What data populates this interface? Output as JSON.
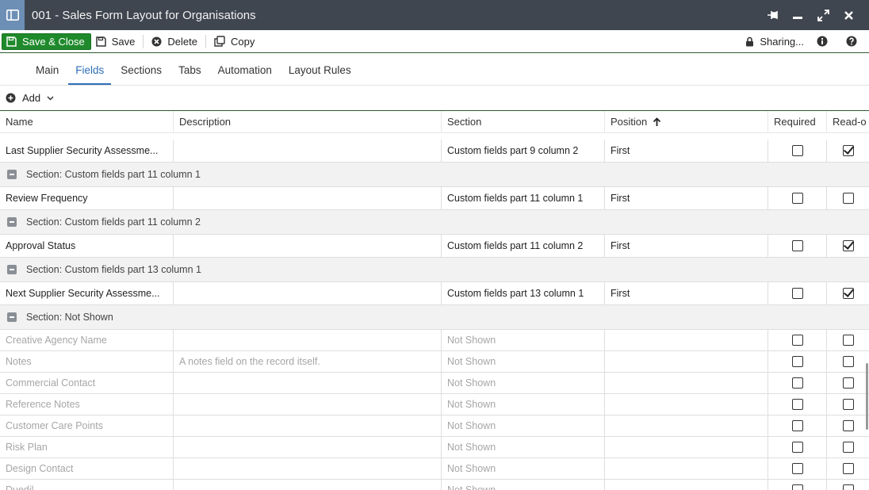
{
  "window": {
    "title": "001 - Sales Form Layout for Organisations"
  },
  "toolbar": {
    "save_close_label": "Save & Close",
    "save_label": "Save",
    "delete_label": "Delete",
    "copy_label": "Copy",
    "sharing_label": "Sharing..."
  },
  "tabs": [
    {
      "label": "Main",
      "active": false
    },
    {
      "label": "Fields",
      "active": true
    },
    {
      "label": "Sections",
      "active": false
    },
    {
      "label": "Tabs",
      "active": false
    },
    {
      "label": "Automation",
      "active": false
    },
    {
      "label": "Layout Rules",
      "active": false
    }
  ],
  "add_bar": {
    "add_label": "Add"
  },
  "table": {
    "columns": {
      "name": "Name",
      "description": "Description",
      "section": "Section",
      "position": "Position",
      "required": "Required",
      "readonly": "Read-o"
    },
    "sort": {
      "column": "Position",
      "direction": "ascending"
    },
    "rows": [
      {
        "type": "field",
        "name": "Last Supplier Security Assessme...",
        "description": "",
        "section": "Custom fields part 9 column 2",
        "position": "First",
        "required": false,
        "readonly": true,
        "muted": false
      },
      {
        "type": "section",
        "label": "Section: Custom fields part 11 column 1"
      },
      {
        "type": "field",
        "name": "Review Frequency",
        "description": "",
        "section": "Custom fields part 11 column 1",
        "position": "First",
        "required": false,
        "readonly": false,
        "muted": false
      },
      {
        "type": "section",
        "label": "Section: Custom fields part 11 column 2"
      },
      {
        "type": "field",
        "name": "Approval Status",
        "description": "",
        "section": "Custom fields part 11 column 2",
        "position": "First",
        "required": false,
        "readonly": true,
        "muted": false
      },
      {
        "type": "section",
        "label": "Section: Custom fields part 13 column 1"
      },
      {
        "type": "field",
        "name": "Next Supplier Security Assessme...",
        "description": "",
        "section": "Custom fields part 13 column 1",
        "position": "First",
        "required": false,
        "readonly": true,
        "muted": false
      },
      {
        "type": "section",
        "label": "Section: Not Shown"
      },
      {
        "type": "field",
        "name": "Creative Agency Name",
        "description": "",
        "section": "Not Shown",
        "position": "",
        "required": false,
        "readonly": false,
        "muted": true
      },
      {
        "type": "field",
        "name": "Notes",
        "description": "A notes field on the record itself.",
        "section": "Not Shown",
        "position": "",
        "required": false,
        "readonly": false,
        "muted": true
      },
      {
        "type": "field",
        "name": "Commercial Contact",
        "description": "",
        "section": "Not Shown",
        "position": "",
        "required": false,
        "readonly": false,
        "muted": true
      },
      {
        "type": "field",
        "name": "Reference Notes",
        "description": "",
        "section": "Not Shown",
        "position": "",
        "required": false,
        "readonly": false,
        "muted": true
      },
      {
        "type": "field",
        "name": "Customer Care Points",
        "description": "",
        "section": "Not Shown",
        "position": "",
        "required": false,
        "readonly": false,
        "muted": true
      },
      {
        "type": "field",
        "name": "Risk Plan",
        "description": "",
        "section": "Not Shown",
        "position": "",
        "required": false,
        "readonly": false,
        "muted": true
      },
      {
        "type": "field",
        "name": "Design Contact",
        "description": "",
        "section": "Not Shown",
        "position": "",
        "required": false,
        "readonly": false,
        "muted": true
      },
      {
        "type": "field",
        "name": "Duedil",
        "description": "",
        "section": "Not Shown",
        "position": "",
        "required": false,
        "readonly": false,
        "muted": true
      }
    ]
  },
  "colors": {
    "titlebar": "#3f4650",
    "primary_button": "#1f8a2c",
    "active_tab": "#2f6fb7",
    "section_row_bg": "#f2f2f2"
  }
}
